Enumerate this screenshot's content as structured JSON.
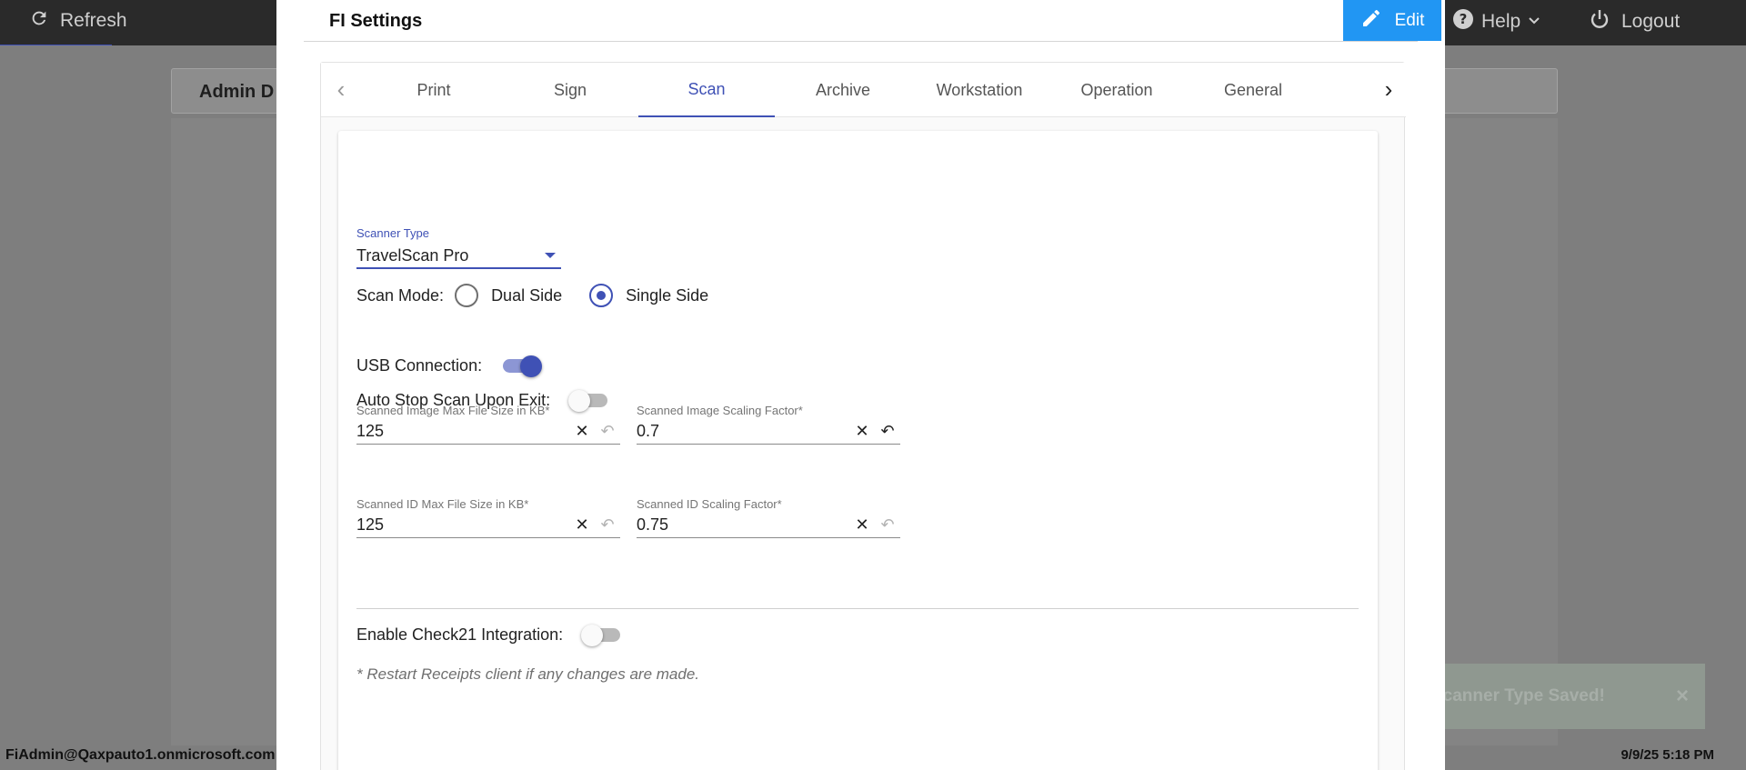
{
  "app": {
    "refresh_label": "Refresh",
    "help_label": "Help",
    "logout_label": "Logout",
    "card_title": "Admin D",
    "user": "FiAdmin@Qaxpauto1.onmicrosoft.com",
    "datetime": "9/9/25 5:18 PM"
  },
  "toast": {
    "message": "Scanner Type Saved!",
    "close": "×"
  },
  "modal": {
    "title": "FI Settings",
    "edit_label": "Edit"
  },
  "tabs": {
    "prev": "‹",
    "next": "›",
    "items": [
      "Print",
      "Sign",
      "Scan",
      "Archive",
      "Workstation",
      "Operation",
      "General"
    ],
    "active": "Scan"
  },
  "scan": {
    "scanner_type": {
      "label": "Scanner Type",
      "value": "TravelScan Pro"
    },
    "scan_mode": {
      "label": "Scan Mode:",
      "options": [
        "Dual Side",
        "Single Side"
      ],
      "selected": "Single Side"
    },
    "usb_connection": {
      "label": "USB Connection:",
      "on": true
    },
    "auto_stop": {
      "label": "Auto Stop Scan Upon Exit:",
      "on": false
    },
    "fields": {
      "image_max_size": {
        "label": "Scanned Image Max File Size in KB*",
        "value": "125"
      },
      "image_scaling": {
        "label": "Scanned Image Scaling Factor*",
        "value": "0.7"
      },
      "id_max_size": {
        "label": "Scanned ID Max File Size in KB*",
        "value": "125"
      },
      "id_scaling": {
        "label": "Scanned ID Scaling Factor*",
        "value": "0.75"
      }
    },
    "check21": {
      "label": "Enable Check21 Integration:",
      "on": false
    },
    "note": "* Restart Receipts client if any changes are made."
  },
  "colors": {
    "accent": "#3f51b5",
    "edit_button": "#2196f3",
    "topbar": "#2a2a2a"
  }
}
